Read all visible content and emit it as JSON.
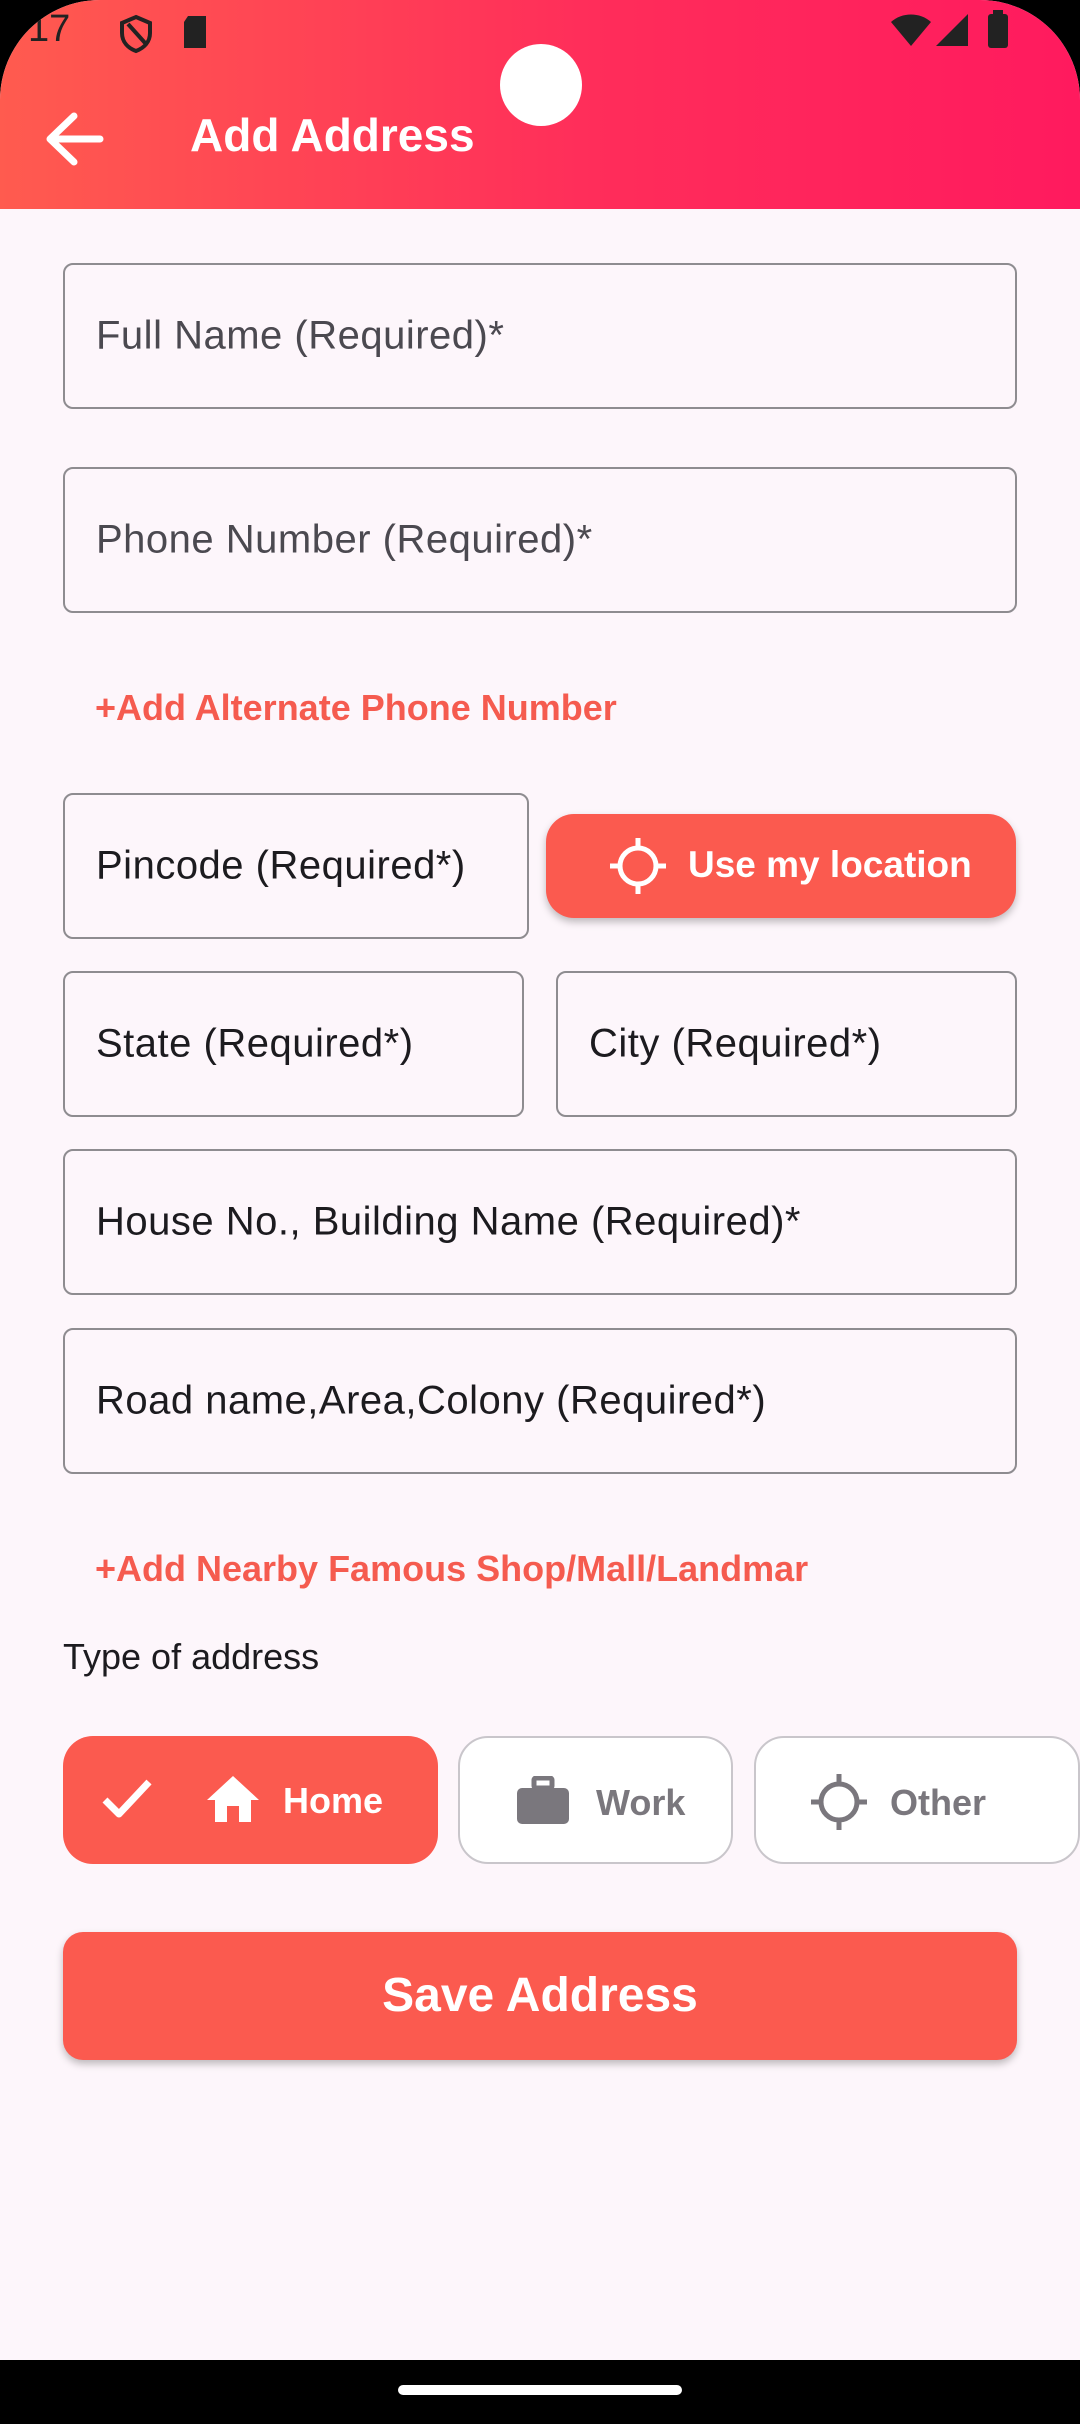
{
  "status_bar": {
    "time": "17"
  },
  "app_bar": {
    "title": "Add Address"
  },
  "form": {
    "full_name": {
      "placeholder": "Full Name (Required)*"
    },
    "phone": {
      "placeholder": "Phone Number (Required)*"
    },
    "add_alt_phone": "+Add Alternate Phone Number",
    "pincode": {
      "placeholder": "Pincode (Required*)"
    },
    "use_location": "Use my location",
    "state": {
      "placeholder": "State (Required*)"
    },
    "city": {
      "placeholder": "City (Required*)"
    },
    "house": {
      "placeholder": "House No., Building Name (Required)*"
    },
    "road": {
      "placeholder": "Road name,Area,Colony (Required*)"
    },
    "add_landmark": "+Add Nearby Famous Shop/Mall/Landmar",
    "type_label": "Type of address",
    "types": [
      {
        "label": "Home",
        "selected": true
      },
      {
        "label": "Work",
        "selected": false
      },
      {
        "label": "Other",
        "selected": false
      }
    ],
    "save_label": "Save Address"
  },
  "colors": {
    "accent": "#fb5a4f",
    "appbar_start": "#ff5b4f",
    "appbar_end": "#ff1a5e",
    "background": "#fdf6fb"
  }
}
